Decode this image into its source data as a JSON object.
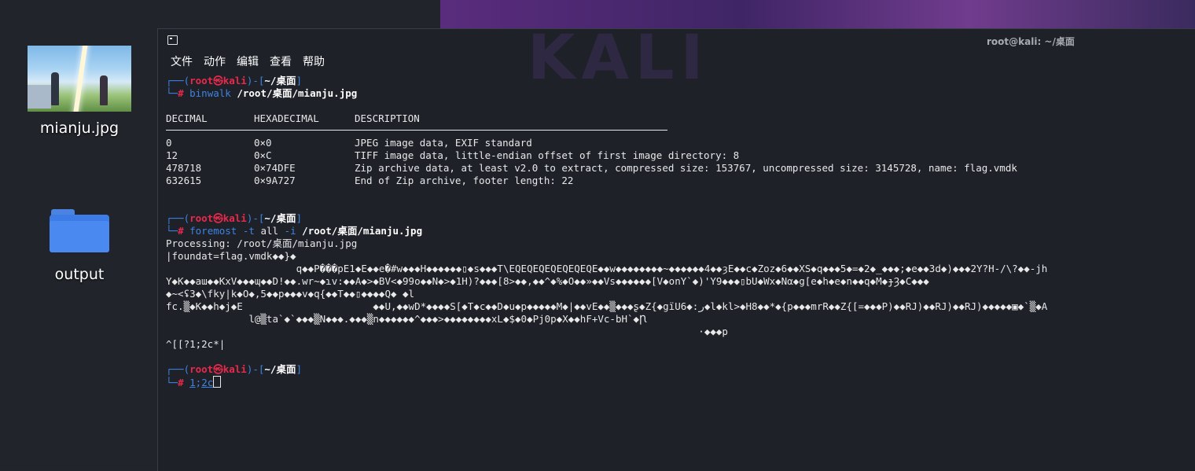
{
  "desktop": {
    "icons": [
      {
        "label": "mianju.jpg"
      },
      {
        "label": "output"
      }
    ]
  },
  "window": {
    "title": "root@kali: ~/桌面",
    "watermark": "KALI",
    "menu": [
      "文件",
      "动作",
      "编辑",
      "查看",
      "帮助"
    ]
  },
  "prompt": {
    "open": "┌──(",
    "user": "root㉿kali",
    "close": ")-[",
    "path": "~/桌面",
    "end": "]",
    "corner": "└─",
    "hash": "#"
  },
  "cmd1": {
    "program": "binwalk",
    "arg": "/root/桌面/mianju.jpg"
  },
  "binwalk": {
    "headers": [
      "DECIMAL",
      "HEXADECIMAL",
      "DESCRIPTION"
    ],
    "rows": [
      [
        "0",
        "0×0",
        "JPEG image data, EXIF standard"
      ],
      [
        "12",
        "0×C",
        "TIFF image data, little-endian offset of first image directory: 8"
      ],
      [
        "478718",
        "0×74DFE",
        "Zip archive data, at least v2.0 to extract, compressed size: 153767, uncompressed size: 3145728, name: flag.vmdk"
      ],
      [
        "632615",
        "0×9A727",
        "End of Zip archive, footer length: 22"
      ]
    ]
  },
  "cmd2": {
    "program": "foremost",
    "opt1": "-t",
    "val1": "all",
    "opt2": "-i",
    "arg": "/root/桌面/mianju.jpg"
  },
  "foremost_output": [
    "Processing: /root/桌面/mianju.jpg",
    "|foundat=flag.vmdk◆◆}◆",
    "                      q◆◆P���pE1◆E◆◆e�#w◆◆◆H◆◆◆◆◆◆▯◆s◆◆◆T\\EQEQEQEQEQEQEQE◆◆w◆◆◆◆◆◆◆◆~◆◆◆◆◆◆4◆◆ȝE◆◆c◆Zoz◆6◆◆XS◆q◆◆◆5◆=◆2◆_◆◆◆;◆e◆◆3d◆)◆◆◆2Y?H-/\\?◆◆-jh",
    "Y◆K◆◆aɯ◆◆KxV◆◆◆ɰ◆◆D!◆◆.wr~◆ɿv:◆◆A◆>◆BV<◆99o◆◆N◆>◆1H)?◆◆◆[8>◆◆,◆◆^◆%◆O◆◆»◆◆Vs◆◆◆◆◆◆[V◆onY`◆)'Y9◆◆◆▯bU◆Wx◆Nα◆g[e◆h◆e◆n◆◆q◆M◆ɟȜ◆C◆◆◆",
    "◆~<ʢ3◆\\fky|k◆O◆,5◆◆p◆◆◆v◆q{◆◆T◆◆▯◆◆◆◆Q◆ ◆l",
    "fc.▒◆K◆◆h◆j◆E                      ◆◆U,◆◆wD*◆◆◆◆S[◆T◆c◆◆D◆u◆p◆◆◆◆◆M◆|◆◆vE◆◆▒◆◆◆ʂ◆Z{◆gïU6◆:ر◆l◆kl>◆H8◆◆*◆{p◆◆◆mrR◆◆Z{[=◆◆◆P)◆◆RJ)◆◆RJ)◆◆RJ)◆◆◆◆◆▣◆`▒◆A",
    "              l@▒ta`◆`◆◆◆▒N◆◆◆.◆◆◆▒n◆◆◆◆◆◆^◆◆◆>◆◆◆◆◆◆◆◆xL◆$◆0◆Pj0p◆X◆◆hF+Vc-bH`◆Ꞃ",
    "                                                                                          ·◆◆◆p",
    "^[[?1;2c*|"
  ],
  "cmd3": {
    "typed_a": "1",
    "typed_b": ";",
    "typed_c": "2c"
  }
}
